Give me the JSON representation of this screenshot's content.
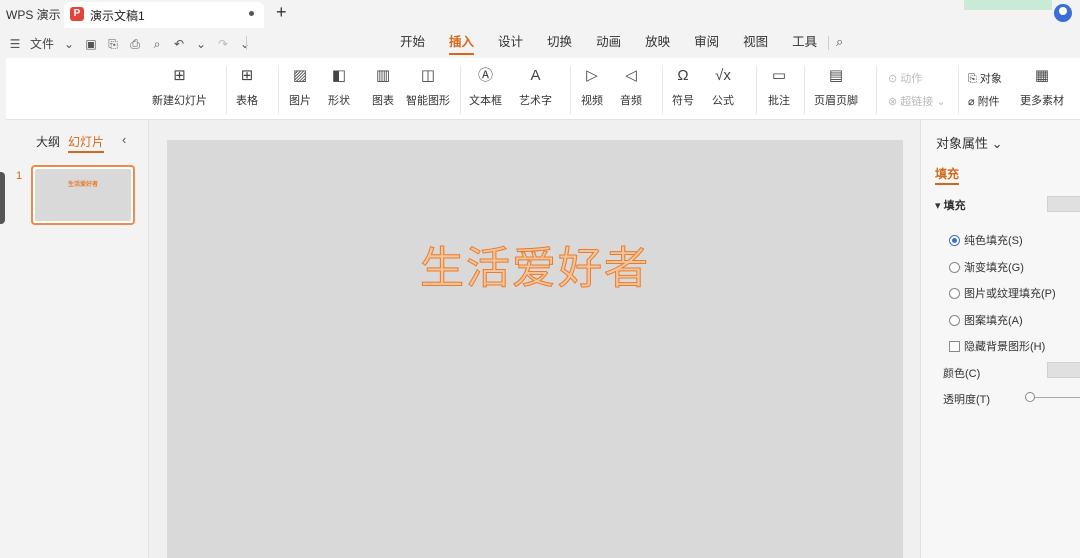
{
  "titlebar": {
    "app_name": "WPS 演示",
    "doc_title": "演示文稿1",
    "doc_icon_letter": "P",
    "new_tab": "+"
  },
  "menubar": {
    "file_label": "文件",
    "tabs": [
      "开始",
      "插入",
      "设计",
      "切换",
      "动画",
      "放映",
      "审阅",
      "视图",
      "工具"
    ],
    "active_tab": "插入"
  },
  "ribbon": {
    "new_slide": "新建幻灯片",
    "table": "表格",
    "picture": "图片",
    "shape": "形状",
    "chart": "图表",
    "smart_graphic": "智能图形",
    "textbox": "文本框",
    "art_text": "艺术字",
    "video": "视频",
    "audio": "音频",
    "symbol": "符号",
    "formula": "公式",
    "comment": "批注",
    "header_footer": "页眉页脚",
    "action": "动作",
    "hyperlink": "超链接",
    "object": "对象",
    "attachment": "附件",
    "more": "更多素材"
  },
  "leftpanel": {
    "outline_tab": "大纲",
    "slides_tab": "幻灯片",
    "slide_number": "1",
    "thumb_title": "生活爱好者"
  },
  "slide": {
    "title": "生活爱好者"
  },
  "rightpanel": {
    "title": "对象属性",
    "tab": "填充",
    "section": "填充",
    "options": [
      {
        "label": "纯色填充(S)",
        "selected": true
      },
      {
        "label": "渐变填充(G)",
        "selected": false
      },
      {
        "label": "图片或纹理填充(P)",
        "selected": false
      },
      {
        "label": "图案填充(A)",
        "selected": false
      }
    ],
    "hide_bg": "隐藏背景图形(H)",
    "color_label": "颜色(C)",
    "transparency_label": "透明度(T)"
  },
  "colors": {
    "accent": "#d2691e",
    "title_fill": "#f6c49a",
    "title_stroke": "#e87b2c"
  }
}
